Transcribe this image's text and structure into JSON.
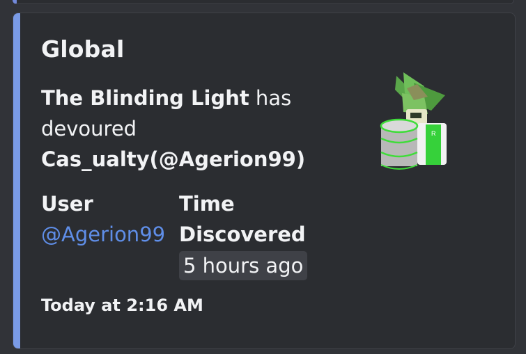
{
  "embed": {
    "title": "Global",
    "description": {
      "actor": "The Blinding Light",
      "verb_has": " has",
      "verb_devoured": "devoured",
      "victim": "Cas_ualty(@Agerion99)"
    },
    "fields": [
      {
        "name": "User",
        "value": "@Agerion99"
      },
      {
        "name": "Time",
        "value_title": "Discovered",
        "value_time": "5 hours ago"
      }
    ],
    "footer": "Today at 2:16 AM",
    "thumbnail_icon": "avatar-icon",
    "colors": {
      "accent": "#7a9be6",
      "link": "#5f8ee8",
      "background": "#2b2d31"
    }
  }
}
